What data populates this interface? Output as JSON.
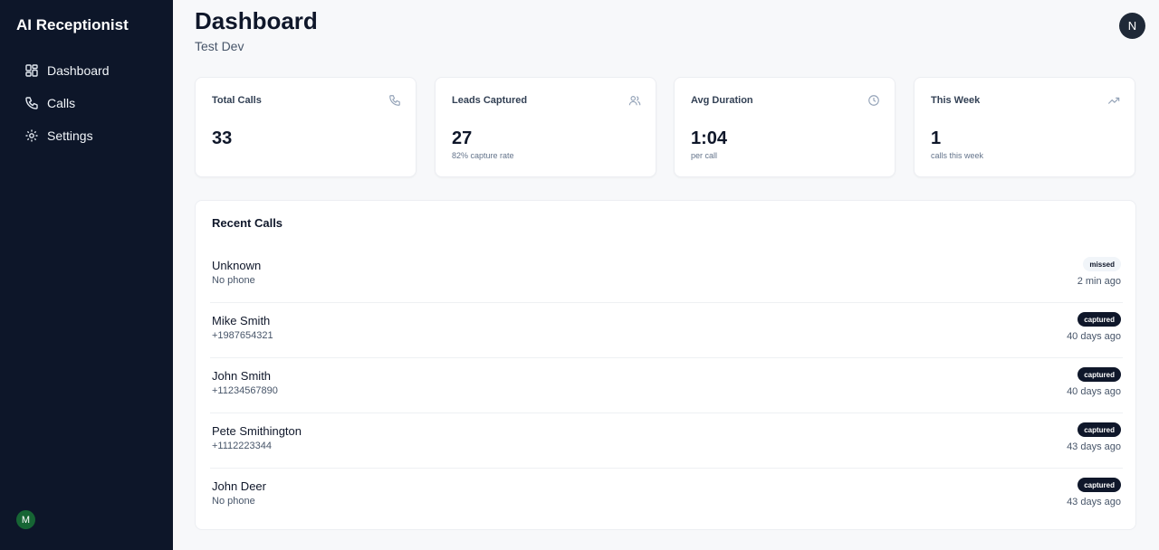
{
  "sidebar": {
    "brand": "AI Receptionist",
    "items": [
      {
        "label": "Dashboard",
        "icon": "dashboard-grid-icon"
      },
      {
        "label": "Calls",
        "icon": "phone-icon"
      },
      {
        "label": "Settings",
        "icon": "gear-icon"
      }
    ],
    "user_initial": "M"
  },
  "header": {
    "title": "Dashboard",
    "subtitle": "Test Dev",
    "avatar_initial": "N"
  },
  "stats": [
    {
      "label": "Total Calls",
      "value": "33",
      "sub": "",
      "icon": "phone-icon"
    },
    {
      "label": "Leads Captured",
      "value": "27",
      "sub": "82% capture rate",
      "icon": "users-icon"
    },
    {
      "label": "Avg Duration",
      "value": "1:04",
      "sub": "per call",
      "icon": "clock-icon"
    },
    {
      "label": "This Week",
      "value": "1",
      "sub": "calls this week",
      "icon": "trending-up-icon"
    }
  ],
  "recent_calls": {
    "title": "Recent Calls",
    "rows": [
      {
        "name": "Unknown",
        "phone": "No phone",
        "status": "missed",
        "time": "2 min ago"
      },
      {
        "name": "Mike Smith",
        "phone": "+1987654321",
        "status": "captured",
        "time": "40 days ago"
      },
      {
        "name": "John Smith",
        "phone": "+11234567890",
        "status": "captured",
        "time": "40 days ago"
      },
      {
        "name": "Pete Smithington",
        "phone": "+1112223344",
        "status": "captured",
        "time": "43 days ago"
      },
      {
        "name": "John Deer",
        "phone": "No phone",
        "status": "captured",
        "time": "43 days ago"
      }
    ]
  },
  "colors": {
    "sidebar_bg": "#0d1629",
    "page_bg": "#f7f8fa",
    "badge_captured": "#0f172a",
    "badge_missed": "#f1f5f9",
    "user_avatar": "#166534"
  }
}
